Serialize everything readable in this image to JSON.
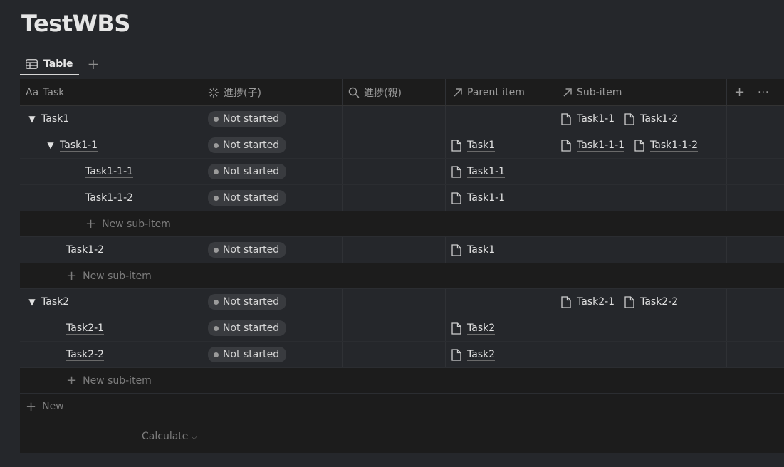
{
  "page": {
    "title": "TestWBS"
  },
  "views": {
    "table_label": "Table",
    "add_label": "+"
  },
  "columns": {
    "task": "Task",
    "child_progress": "進捗(子)",
    "parent_progress": "進捗(親)",
    "parent_item": "Parent item",
    "sub_item": "Sub-item",
    "add": "+",
    "more": "···"
  },
  "rows": [
    {
      "task": "Task1",
      "expanded": true,
      "status": "Not started",
      "parent": "",
      "subs": [
        "Task1-1",
        "Task1-2"
      ]
    },
    {
      "task": "Task1-1",
      "expanded": true,
      "status": "Not started",
      "parent": "Task1",
      "subs": [
        "Task1-1-1",
        "Task1-1-2"
      ]
    },
    {
      "task": "Task1-1-1",
      "status": "Not started",
      "parent": "Task1-1",
      "subs": []
    },
    {
      "task": "Task1-1-2",
      "status": "Not started",
      "parent": "Task1-1",
      "subs": []
    },
    {
      "task": "Task1-2",
      "status": "Not started",
      "parent": "Task1",
      "subs": []
    },
    {
      "task": "Task2",
      "expanded": true,
      "status": "Not started",
      "parent": "",
      "subs": [
        "Task2-1",
        "Task2-2"
      ]
    },
    {
      "task": "Task2-1",
      "status": "Not started",
      "parent": "Task2",
      "subs": []
    },
    {
      "task": "Task2-2",
      "status": "Not started",
      "parent": "Task2",
      "subs": []
    }
  ],
  "new_sub_item_label": "New sub-item",
  "new_label": "New",
  "calculate_label": "Calculate",
  "colors": {
    "background": "#25272b",
    "header_bg": "#1c1c1c",
    "status_pill": "#393b3f"
  }
}
